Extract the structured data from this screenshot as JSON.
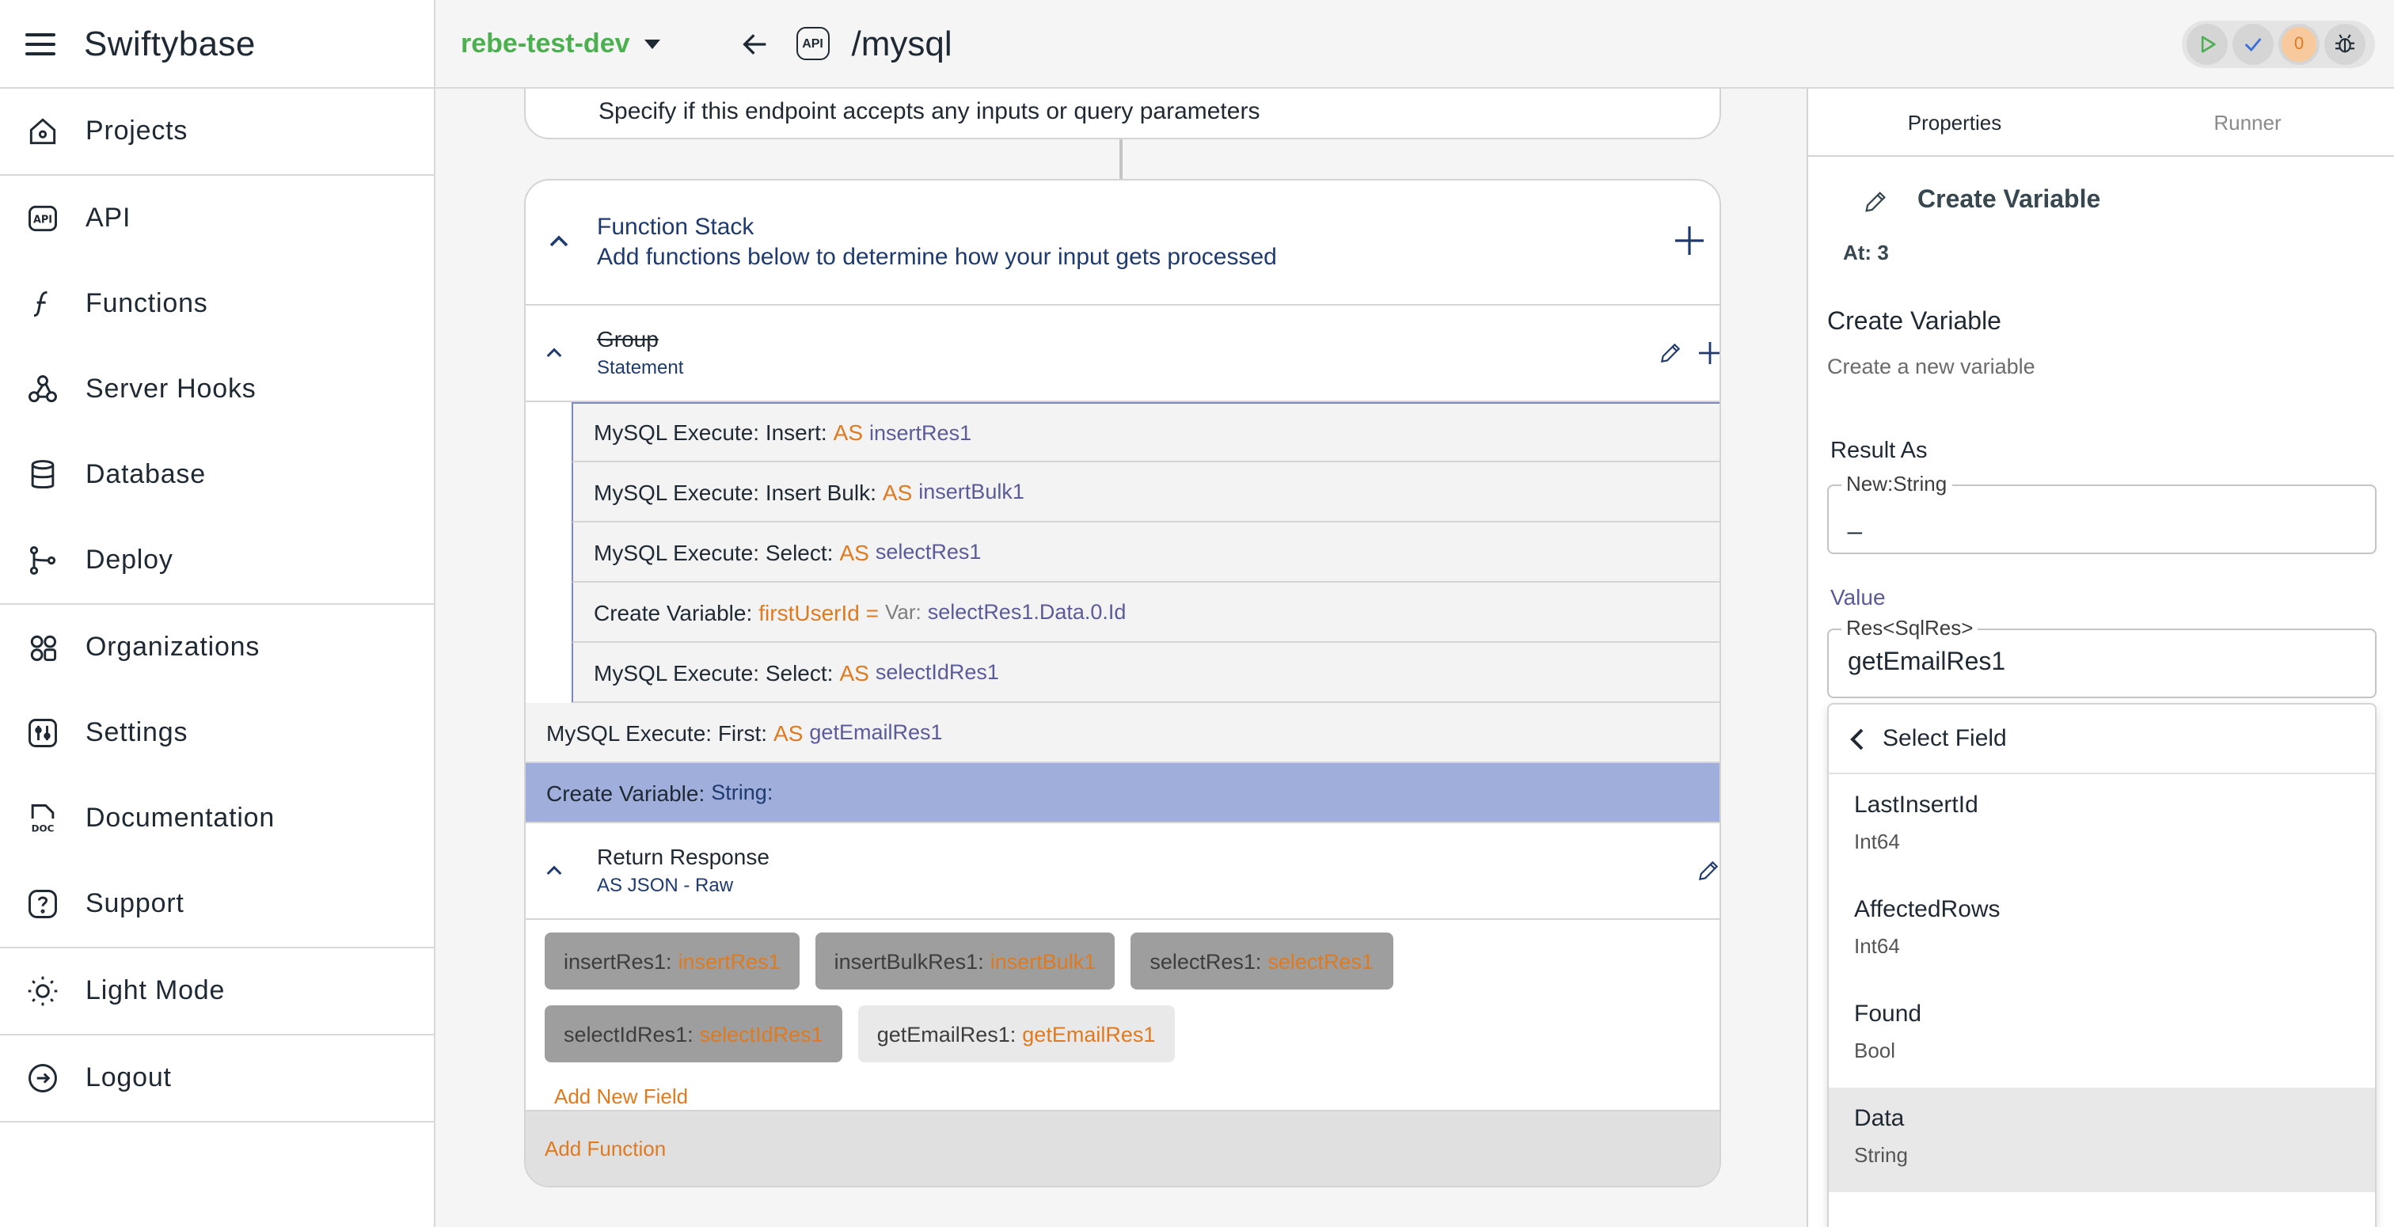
{
  "app": {
    "title": "Swiftybase"
  },
  "sidebar": {
    "items": [
      {
        "label": "Projects",
        "icon": "home-icon"
      },
      {
        "label": "API",
        "icon": "api-icon"
      },
      {
        "label": "Functions",
        "icon": "function-icon"
      },
      {
        "label": "Server Hooks",
        "icon": "webhook-icon"
      },
      {
        "label": "Database",
        "icon": "database-icon"
      },
      {
        "label": "Deploy",
        "icon": "branch-icon"
      },
      {
        "label": "Organizations",
        "icon": "organizations-icon"
      },
      {
        "label": "Settings",
        "icon": "settings-icon"
      },
      {
        "label": "Documentation",
        "icon": "doc-icon"
      },
      {
        "label": "Support",
        "icon": "help-icon"
      },
      {
        "label": "Light Mode",
        "icon": "sun-icon"
      },
      {
        "label": "Logout",
        "icon": "logout-icon"
      }
    ]
  },
  "topbar": {
    "project": "rebe-test-dev",
    "api_badge": "API",
    "path": "/mysql",
    "issue_count": "0"
  },
  "canvas": {
    "input_sub": "Specify if this endpoint accepts any inputs or query parameters",
    "function_stack": {
      "title": "Function Stack",
      "subtitle": "Add functions below to determine how your input gets processed"
    },
    "group": {
      "title": "Group",
      "subtitle": "Statement"
    },
    "group_rows": [
      {
        "label": "MySQL Execute: Insert:",
        "kw": "AS",
        "var": "insertRes1"
      },
      {
        "label": "MySQL Execute: Insert Bulk:",
        "kw": "AS",
        "var": "insertBulk1"
      },
      {
        "label": "MySQL Execute: Select:",
        "kw": "AS",
        "var": "selectRes1"
      },
      {
        "label": "Create Variable:",
        "kw": "firstUserId =",
        "muted": "Var:",
        "var": "selectRes1.Data.0.Id"
      },
      {
        "label": "MySQL Execute: Select:",
        "kw": "AS",
        "var": "selectIdRes1"
      }
    ],
    "rows": [
      {
        "label": "MySQL Execute: First:",
        "kw": "AS",
        "var": "getEmailRes1"
      },
      {
        "label": "Create Variable:",
        "var": "String:"
      }
    ],
    "return": {
      "title": "Return Response",
      "subtitle": "AS JSON - Raw"
    },
    "fields": [
      {
        "key": "insertRes1:",
        "value": "insertRes1"
      },
      {
        "key": "insertBulkRes1:",
        "value": "insertBulk1"
      },
      {
        "key": "selectRes1:",
        "value": "selectRes1"
      },
      {
        "key": "selectIdRes1:",
        "value": "selectIdRes1"
      },
      {
        "key": "getEmailRes1:",
        "value": "getEmailRes1"
      }
    ],
    "add_field": "Add New Field",
    "add_function": "Add Function"
  },
  "panel": {
    "tabs": [
      "Properties",
      "Runner"
    ],
    "title": "Create Variable",
    "at": "At: 3",
    "section_title": "Create Variable",
    "section_sub": "Create a new variable",
    "result_as_label": "Result As",
    "result_legend": "New:String",
    "result_value": "_",
    "value_label": "Value",
    "value_legend": "Res<SqlRes>",
    "value_value": "getEmailRes1",
    "dropdown": {
      "header": "Select Field",
      "items": [
        {
          "name": "LastInsertId",
          "type": "Int64"
        },
        {
          "name": "AffectedRows",
          "type": "Int64"
        },
        {
          "name": "Found",
          "type": "Bool"
        },
        {
          "name": "Data",
          "type": "String"
        }
      ]
    }
  },
  "colors": {
    "accent_orange": "#e07a1f",
    "project_green": "#4caf50",
    "navy": "#1e3a6e",
    "selected_row": "#a0aedc"
  }
}
